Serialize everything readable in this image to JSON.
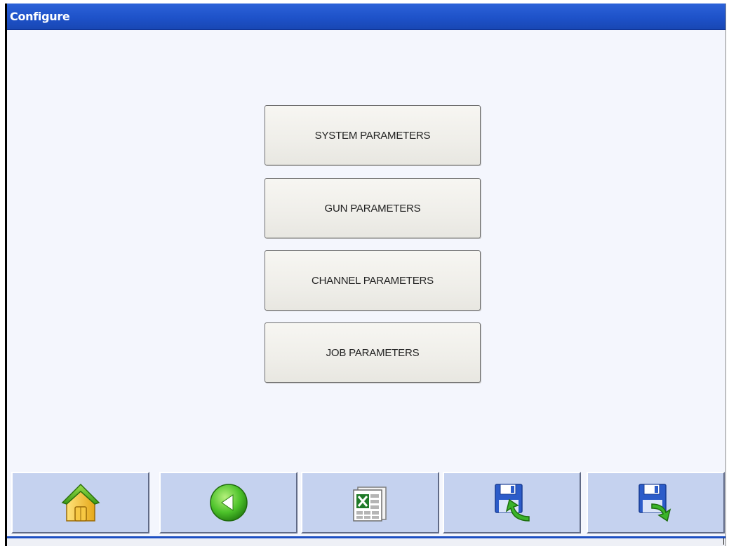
{
  "window": {
    "title": "Configure"
  },
  "menu": {
    "items": [
      {
        "label": "SYSTEM PARAMETERS"
      },
      {
        "label": "GUN PARAMETERS"
      },
      {
        "label": "CHANNEL PARAMETERS"
      },
      {
        "label": "JOB PARAMETERS"
      }
    ]
  },
  "toolbar": {
    "buttons": [
      {
        "icon": "home-icon"
      },
      {
        "icon": "back-arrow-icon"
      },
      {
        "icon": "spreadsheet-export-icon"
      },
      {
        "icon": "load-disk-icon"
      },
      {
        "icon": "save-disk-icon"
      }
    ]
  },
  "colors": {
    "titlebar": "#1e52c9",
    "background": "#f4f6fd",
    "toolbar_button": "#c5d2ef",
    "menu_button": "#efeee9"
  }
}
